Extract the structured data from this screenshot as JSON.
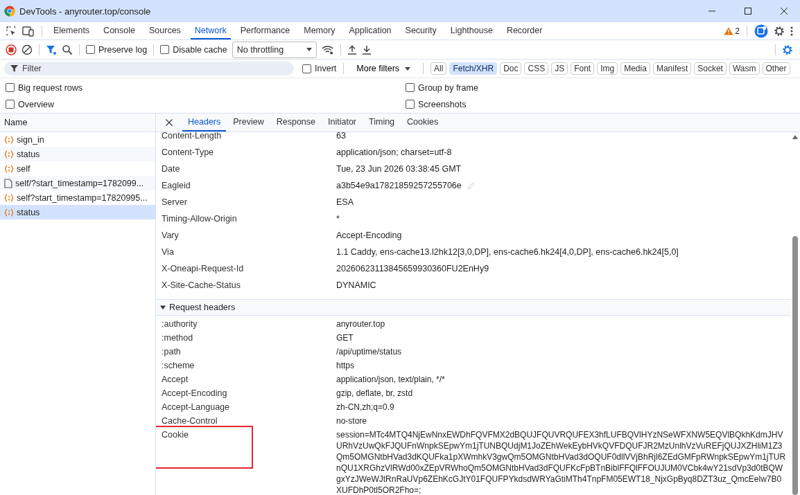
{
  "window": {
    "title": "DevTools - anyrouter.top/console"
  },
  "panel_tabs": [
    {
      "label": "Elements",
      "selected": false
    },
    {
      "label": "Console",
      "selected": false
    },
    {
      "label": "Sources",
      "selected": false
    },
    {
      "label": "Network",
      "selected": true
    },
    {
      "label": "Performance",
      "selected": false
    },
    {
      "label": "Memory",
      "selected": false
    },
    {
      "label": "Application",
      "selected": false
    },
    {
      "label": "Security",
      "selected": false
    },
    {
      "label": "Lighthouse",
      "selected": false
    },
    {
      "label": "Recorder",
      "selected": false
    }
  ],
  "warnings_count": "2",
  "toolbar": {
    "preserve_log": {
      "label": "Preserve log",
      "checked": false
    },
    "disable_cache": {
      "label": "Disable cache",
      "checked": false
    },
    "throttling": "No throttling"
  },
  "filter": {
    "placeholder": "Filter",
    "invert": {
      "label": "Invert",
      "checked": false
    },
    "more_filters": "More filters",
    "types": [
      {
        "label": "All",
        "selected": false
      },
      {
        "label": "Fetch/XHR",
        "selected": true
      },
      {
        "label": "Doc",
        "selected": false
      },
      {
        "label": "CSS",
        "selected": false
      },
      {
        "label": "JS",
        "selected": false
      },
      {
        "label": "Font",
        "selected": false
      },
      {
        "label": "Img",
        "selected": false
      },
      {
        "label": "Media",
        "selected": false
      },
      {
        "label": "Manifest",
        "selected": false
      },
      {
        "label": "Socket",
        "selected": false
      },
      {
        "label": "Wasm",
        "selected": false
      },
      {
        "label": "Other",
        "selected": false
      }
    ]
  },
  "options": [
    {
      "label": "Big request rows",
      "checked": false
    },
    {
      "label": "Group by frame",
      "checked": false
    },
    {
      "label": "Overview",
      "checked": false
    },
    {
      "label": "Screenshots",
      "checked": false
    }
  ],
  "requests": {
    "column": "Name",
    "items": [
      {
        "name": "sign_in",
        "kind": "xhr",
        "selected": false
      },
      {
        "name": "status",
        "kind": "xhr",
        "selected": false
      },
      {
        "name": "self",
        "kind": "xhr",
        "selected": false
      },
      {
        "name": "self/?start_timestamp=1782099...",
        "kind": "doc",
        "selected": false
      },
      {
        "name": "self?start_timestamp=17820995...",
        "kind": "xhr",
        "selected": false
      },
      {
        "name": "status",
        "kind": "xhr",
        "selected": true
      }
    ]
  },
  "detail_tabs": [
    {
      "label": "Headers",
      "selected": true
    },
    {
      "label": "Preview",
      "selected": false
    },
    {
      "label": "Response",
      "selected": false
    },
    {
      "label": "Initiator",
      "selected": false
    },
    {
      "label": "Timing",
      "selected": false
    },
    {
      "label": "Cookies",
      "selected": false
    }
  ],
  "response_headers": [
    {
      "name": "Content-Length",
      "value": "63",
      "editable": false
    },
    {
      "name": "Content-Type",
      "value": "application/json; charset=utf-8",
      "editable": false
    },
    {
      "name": "Date",
      "value": "Tue, 23 Jun 2026 03:38:45 GMT",
      "editable": false
    },
    {
      "name": "Eagleid",
      "value": "a3b54e9a17821859257255706e",
      "editable": true
    },
    {
      "name": "Server",
      "value": "ESA",
      "editable": false
    },
    {
      "name": "Timing-Allow-Origin",
      "value": "*",
      "editable": false
    },
    {
      "name": "Vary",
      "value": "Accept-Encoding",
      "editable": false
    },
    {
      "name": "Via",
      "value": "1.1 Caddy, ens-cache13.l2hk12[3,0,DP], ens-cache6.hk24[4,0,DP], ens-cache6.hk24[5,0]",
      "editable": false
    },
    {
      "name": "X-Oneapi-Request-Id",
      "value": "20260623113845659930360FU2EnHy9",
      "editable": false
    },
    {
      "name": "X-Site-Cache-Status",
      "value": "DYNAMIC",
      "editable": false
    }
  ],
  "request_headers": {
    "title": "Request headers",
    "expanded": true,
    "rows": [
      {
        "name": ":authority",
        "value": "anyrouter.top"
      },
      {
        "name": ":method",
        "value": "GET"
      },
      {
        "name": ":path",
        "value": "/api/uptime/status"
      },
      {
        "name": ":scheme",
        "value": "https"
      },
      {
        "name": "Accept",
        "value": "application/json, text/plain, */*"
      },
      {
        "name": "Accept-Encoding",
        "value": "gzip, deflate, br, zstd"
      },
      {
        "name": "Accept-Language",
        "value": "zh-CN,zh;q=0.9"
      },
      {
        "name": "Cache-Control",
        "value": "no-store"
      },
      {
        "name": "Cookie",
        "value": "session=MTc4MTQ4NjEwNnxEWDhFQVFMX2dBQUJFQUVRQUFEX3hfLUFBQVlHYzNSeWFXNW5EQVlBQkhKdmJHVURhVzUwQkFJQUFnWnpkSEpwYm1jTUNBQUdjM1JoZEhWekEybHVkQVFDQUFJR2MzUnlhVzVuREFjQUJXZHliM1Z3Qm5OMGNtbHVad3dKQUFka1pXWmhkV3gwQm5OMGNtbHVad3dOQUF0dllVVjBhRjl6ZEdGMFpRWnpkSEpwYm1jTURnQU1XRGhzVlRWd00xZEpVRWhoQm5OMGNtbHVad3dFQUFKcFpBTnBiblFFQlFFOUJUM0VCbk4wY21sdVp3d0tBQWgxYzJWeWJtRnRaUVp6ZEhKcGJtY01FQUFPYkdsdWRYaGtiMTh4TnpFM05EWT18_NjxGpByq8DZT3uz_QmcEelw7B0XUFDhP0tl5OR2Fho=;"
      }
    ]
  },
  "annotation": {
    "kind": "box",
    "color": "#e8262d"
  }
}
